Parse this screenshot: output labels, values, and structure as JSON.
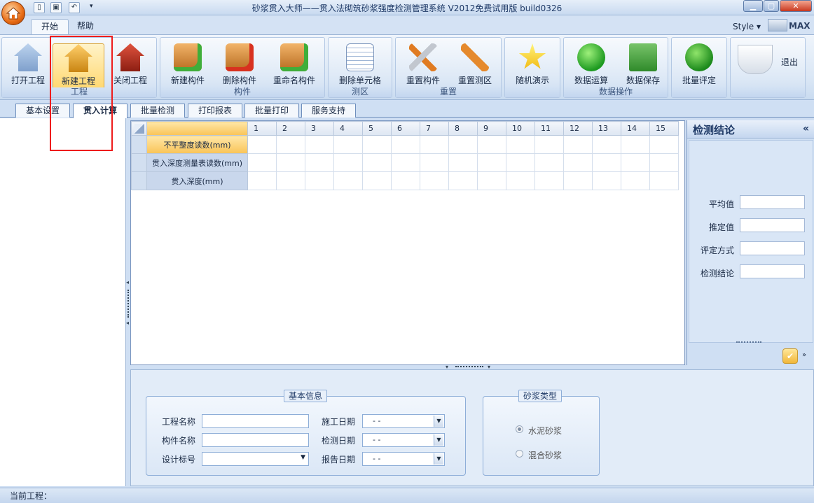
{
  "window": {
    "title": "砂浆贯入大师——贯入法砌筑砂浆强度检测管理系统  V2012免费试用版 build0326",
    "style_label": "Style",
    "max_label": "MAX"
  },
  "ribbon_tabs": [
    {
      "label": "开始",
      "active": true
    },
    {
      "label": "帮助",
      "active": false
    }
  ],
  "ribbon_groups": [
    {
      "label": "工程",
      "buttons": [
        {
          "label": "打开工程",
          "icon": "house-search-icon"
        },
        {
          "label": "新建工程",
          "icon": "house-add-icon",
          "selected": true
        },
        {
          "label": "关闭工程",
          "icon": "house-close-icon"
        }
      ]
    },
    {
      "label": "构件",
      "buttons": [
        {
          "label": "新建构件",
          "icon": "box-add-icon"
        },
        {
          "label": "删除构件",
          "icon": "box-delete-icon"
        },
        {
          "label": "重命名构件",
          "icon": "box-rename-icon"
        }
      ]
    },
    {
      "label": "测区",
      "buttons": [
        {
          "label": "删除单元格",
          "icon": "sheet-delete-icon"
        }
      ]
    },
    {
      "label": "重置",
      "buttons": [
        {
          "label": "重置构件",
          "icon": "tools-icon"
        },
        {
          "label": "重置测区",
          "icon": "wrench-icon"
        }
      ]
    },
    {
      "label": "",
      "buttons": [
        {
          "label": "随机演示",
          "icon": "star-icon"
        }
      ]
    },
    {
      "label": "数据操作",
      "buttons": [
        {
          "label": "数据运算",
          "icon": "play-icon"
        },
        {
          "label": "数据保存",
          "icon": "floppy-icon"
        }
      ]
    },
    {
      "label": "",
      "buttons": [
        {
          "label": "批量评定",
          "icon": "check-icon"
        }
      ]
    },
    {
      "label": "",
      "buttons": [
        {
          "label": "退出",
          "icon": "coffee-icon"
        }
      ]
    }
  ],
  "main_tabs": [
    {
      "label": "基本设置",
      "active": false
    },
    {
      "label": "贯入计算",
      "active": true
    },
    {
      "label": "批量检测",
      "active": false
    },
    {
      "label": "打印报表",
      "active": false
    },
    {
      "label": "批量打印",
      "active": false
    },
    {
      "label": "服务支持",
      "active": false
    }
  ],
  "grid": {
    "columns": [
      "1",
      "2",
      "3",
      "4",
      "5",
      "6",
      "7",
      "8",
      "9",
      "10",
      "11",
      "12",
      "13",
      "14",
      "15"
    ],
    "rows": [
      {
        "label": "不平整度读数(mm)",
        "current": true
      },
      {
        "label": "贯入深度测量表读数(mm)",
        "current": false
      },
      {
        "label": "贯入深度(mm)",
        "current": false
      }
    ]
  },
  "results_panel": {
    "title": "检测结论",
    "collapse_glyph": "«",
    "fields": [
      {
        "label": "平均值",
        "value": ""
      },
      {
        "label": "推定值",
        "value": ""
      },
      {
        "label": "评定方式",
        "value": ""
      },
      {
        "label": "检测结论",
        "value": ""
      }
    ]
  },
  "basic_info": {
    "legend": "基本信息",
    "project_name_label": "工程名称",
    "project_name_value": "",
    "component_name_label": "构件名称",
    "component_name_value": "",
    "design_grade_label": "设计标号",
    "design_grade_value": "",
    "construction_date_label": "施工日期",
    "construction_date_value": "-    -",
    "inspection_date_label": "检测日期",
    "inspection_date_value": "-    -",
    "report_date_label": "报告日期",
    "report_date_value": "-    -"
  },
  "mortar_type": {
    "legend": "砂浆类型",
    "options": [
      {
        "label": "水泥砂浆",
        "checked": true
      },
      {
        "label": "混合砂浆",
        "checked": false
      }
    ]
  },
  "status_bar": {
    "current_project_label": "当前工程："
  },
  "colors": {
    "ribbon_bg": "#d9e6f5",
    "highlight": "#ee1c1c",
    "selected_button": "#ffd66a"
  }
}
